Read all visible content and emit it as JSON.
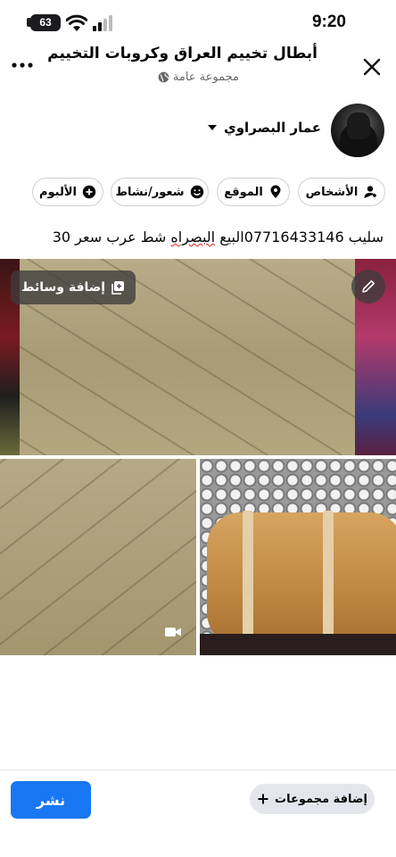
{
  "status_bar": {
    "time": "9:20",
    "battery_level": "63"
  },
  "header": {
    "group_title": "أبطال تخييم العراق وكروبات التخييم",
    "privacy_label": "مجموعة عامة",
    "icons": {
      "close": "close-icon",
      "more": "more-icon",
      "privacy": "globe-icon"
    }
  },
  "author": {
    "name": "عمار البصراوي"
  },
  "chips": [
    {
      "label": "الأشخاص",
      "icon": "tag-people-icon"
    },
    {
      "label": "الموقع",
      "icon": "location-pin-icon"
    },
    {
      "label": "شعور/نشاط",
      "icon": "smiley-icon"
    },
    {
      "label": "الألبوم",
      "icon": "plus-circle-icon"
    }
  ],
  "post": {
    "text_before": "سليب 07716433146البيع ",
    "text_underlined": "البصراه",
    "text_after": " شط عرب سعر 30"
  },
  "media": {
    "add_media_label": "إضافة وسائط",
    "icons": {
      "add_media": "add-media-icon",
      "edit": "pencil-icon",
      "video": "video-camera-icon"
    }
  },
  "bottom_bar": {
    "post_label": "نشر",
    "add_groups_label": "إضافة مجموعات"
  },
  "colors": {
    "primary": "#1877f2",
    "chip_border": "#ced0d4",
    "secondary_text": "#65676b"
  }
}
